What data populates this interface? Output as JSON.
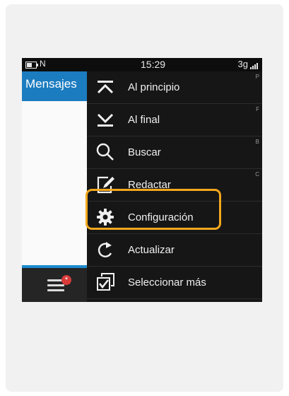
{
  "status_bar": {
    "nfc": "N",
    "time": "15:29",
    "network": "3g"
  },
  "app": {
    "title": "Mensajes",
    "notification_badge": "*"
  },
  "menu": {
    "items": [
      {
        "label": "Al principio",
        "key": "P",
        "icon": "arrow-up-icon"
      },
      {
        "label": "Al final",
        "key": "F",
        "icon": "arrow-down-icon"
      },
      {
        "label": "Buscar",
        "key": "B",
        "icon": "search-icon"
      },
      {
        "label": "Redactar",
        "key": "C",
        "icon": "compose-icon"
      },
      {
        "label": "Configuración",
        "key": "",
        "icon": "gear-icon"
      },
      {
        "label": "Actualizar",
        "key": "",
        "icon": "refresh-icon"
      },
      {
        "label": "Seleccionar más",
        "key": "",
        "icon": "select-more-icon"
      }
    ],
    "highlighted_item": "Configuración"
  },
  "colors": {
    "accent": "#1c7cc0",
    "highlight": "#f3a81e",
    "menu_bg": "#161616"
  }
}
